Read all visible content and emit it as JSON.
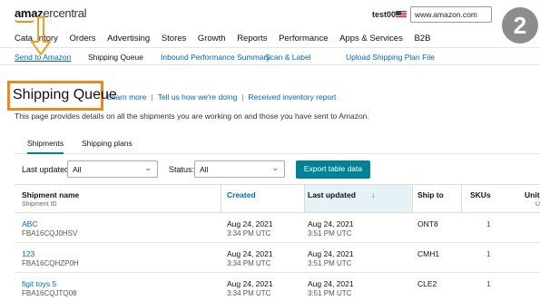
{
  "header": {
    "logo_bold": "amaz",
    "logo_light": "ercentral",
    "user": "test008",
    "marketplace": "www.amazon.com"
  },
  "nav": {
    "items": [
      "Cata",
      "ntory",
      "Orders",
      "Advertising",
      "Stores",
      "Growth",
      "Reports",
      "Performance",
      "Apps & Services",
      "B2B"
    ]
  },
  "subnav": {
    "items": [
      "Send to Amazon",
      "Shipping Queue",
      "Inbound Performance Summary",
      "Scan & Label",
      "Upload Shipping Plan File"
    ]
  },
  "page": {
    "title": "Shipping Queue",
    "links": [
      "Learn more",
      "Tell us how we're doing",
      "Received inventory report"
    ],
    "description": "This page provides details on all the shipments you are working on and those you have sent to Amazon."
  },
  "tabs": [
    "Shipments",
    "Shipping plans"
  ],
  "filters": {
    "last_updated_label": "Last updated:",
    "last_updated_value": "All",
    "status_label": "Status:",
    "status_value": "All",
    "export_label": "Export table data"
  },
  "table": {
    "columns": {
      "name": "Shipment name",
      "name_sub": "Shipment ID",
      "created": "Created",
      "last_updated": "Last updated",
      "sort_arrow": "↓",
      "ship_to": "Ship to",
      "skus": "SKUs",
      "units": "Unit",
      "units_sub": "U"
    },
    "rows": [
      {
        "name": "ABC",
        "id": "FBA16CQJ0HSV",
        "created_date": "Aug 24, 2021",
        "created_time": "3:34 PM UTC",
        "updated_date": "Aug 24, 2021",
        "updated_time": "3:51 PM UTC",
        "ship_to": "ONT8",
        "skus": "1"
      },
      {
        "name": "123",
        "id": "FBA16CQHZP0H",
        "created_date": "Aug 24, 2021",
        "created_time": "3:34 PM UTC",
        "updated_date": "Aug 24, 2021",
        "updated_time": "3:51 PM UTC",
        "ship_to": "CMH1",
        "skus": "1"
      },
      {
        "name": "figit toys 5",
        "id": "FBA16CQJTQ08",
        "created_date": "Aug 24, 2021",
        "created_time": "3:34 PM UTC",
        "updated_date": "Aug 24, 2021",
        "updated_time": "3:51 PM UTC",
        "ship_to": "CLE2",
        "skus": "1"
      }
    ]
  },
  "step_badge": "2",
  "colors": {
    "accent": "#008296",
    "link": "#0066c0",
    "highlight": "#f0871a",
    "badge": "#8c8c8c"
  }
}
